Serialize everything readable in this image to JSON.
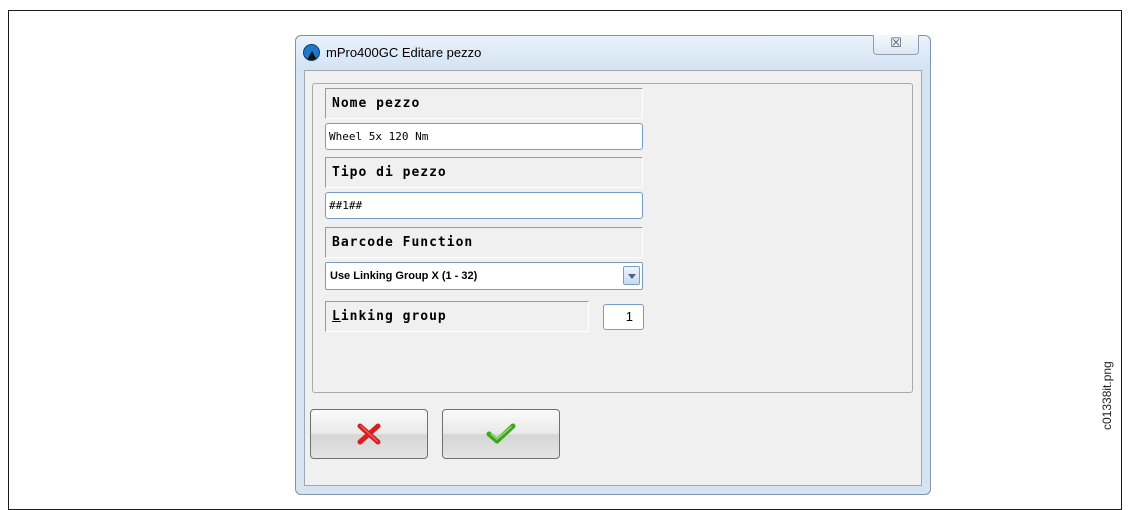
{
  "window": {
    "title": "mPro400GC Editare pezzo",
    "icon": "app-logo-icon",
    "close_glyph": "☒"
  },
  "form": {
    "part_name_label": "Nome pezzo",
    "part_name_value": "Wheel 5x 120 Nm",
    "part_type_label": "Tipo di pezzo",
    "part_type_value": "##1##",
    "barcode_label": "Barcode Function",
    "barcode_selected": "Use Linking Group X (1 - 32)",
    "linking_label_accel": "L",
    "linking_label_rest": "inking group",
    "linking_value": "1"
  },
  "buttons": {
    "cancel_icon": "red-x-icon",
    "ok_icon": "green-check-icon",
    "cancel_color": "#d62020",
    "ok_color": "#3fa51c"
  },
  "caption": "c01338it.png"
}
